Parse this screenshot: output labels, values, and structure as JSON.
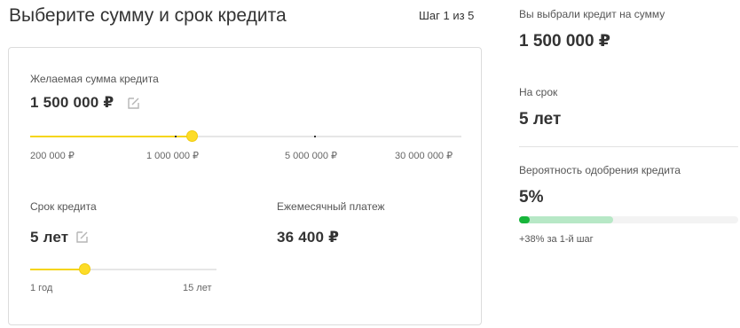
{
  "header": {
    "title": "Выберите сумму и срок кредита",
    "step": "Шаг 1 из 5"
  },
  "amount": {
    "label": "Желаемая сумма кредита",
    "value": "1 500 000 ₽",
    "slider_fraction": 0.375,
    "ticks": [
      "200 000 ₽",
      "1 000 000 ₽",
      "5 000 000 ₽",
      "30 000 000 ₽"
    ]
  },
  "term": {
    "label": "Срок кредита",
    "value": "5 лет",
    "slider_fraction": 0.29,
    "ticks": [
      "1 год",
      "15 лет"
    ]
  },
  "payment": {
    "label": "Ежемесячный платеж",
    "value": "36 400 ₽"
  },
  "summary": {
    "amount_label": "Вы выбрали кредит на сумму",
    "amount_value": "1 500 000 ₽",
    "term_label": "На срок",
    "term_value": "5 лет",
    "probability_label": "Вероятность одобрения кредита",
    "probability_value": "5%",
    "probability_base_fraction": 0.05,
    "probability_potential_fraction": 0.43,
    "probability_note": "+38% за 1-й шаг"
  },
  "colors": {
    "accent_yellow": "#fddc28",
    "success_green": "#17b53a",
    "success_light": "#b7e8c6"
  }
}
